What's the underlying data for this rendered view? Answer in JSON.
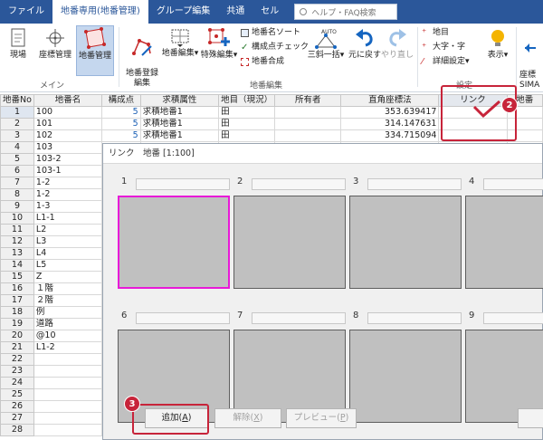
{
  "menubar": {
    "tabs": [
      {
        "label": "ファイル",
        "active": false
      },
      {
        "label": "地番専用(地番管理)",
        "active": true
      },
      {
        "label": "グループ編集",
        "active": false
      },
      {
        "label": "共通",
        "active": false
      },
      {
        "label": "セル",
        "active": false
      }
    ],
    "help_placeholder": "ヘルプ・FAQ検索"
  },
  "ribbon": {
    "main": {
      "items": [
        "現場",
        "座標管理",
        "地番管理"
      ],
      "group": "メイン"
    },
    "chiban": {
      "items": [
        "地番登録\n編集",
        "地番編集",
        "特殊編集"
      ],
      "sort": "地番名ソート",
      "check": "構成点チェック",
      "merge": "地番合成",
      "sankyaku": "三斜一括",
      "undo": "元に戻す",
      "redo": "やり直し",
      "group": "地番編集"
    },
    "settings": {
      "chimoku": "地目",
      "font": "大字・字",
      "detail": "詳細設定",
      "display": "表示",
      "zahyo": "座標\nSIMA",
      "group": "設定"
    }
  },
  "grid": {
    "columns": [
      "地番No",
      "地番名",
      "構成点",
      "求積属性",
      "地目（現況）",
      "所有者",
      "直角座標法",
      "リンク",
      "地番"
    ],
    "rows": [
      {
        "no": "1",
        "name": "100",
        "points": "5",
        "attr": "求積地番1",
        "chimoku": "田",
        "owner": "",
        "area": "353.639417",
        "link": ""
      },
      {
        "no": "2",
        "name": "101",
        "points": "5",
        "attr": "求積地番1",
        "chimoku": "田",
        "owner": "",
        "area": "314.147631",
        "link": ""
      },
      {
        "no": "3",
        "name": "102",
        "points": "5",
        "attr": "求積地番1",
        "chimoku": "田",
        "owner": "",
        "area": "334.715094",
        "link": ""
      },
      {
        "no": "4",
        "name": "103"
      },
      {
        "no": "5",
        "name": "103-2"
      },
      {
        "no": "6",
        "name": "103-1"
      },
      {
        "no": "7",
        "name": "1-2"
      },
      {
        "no": "8",
        "name": "1-2"
      },
      {
        "no": "9",
        "name": "1-3"
      },
      {
        "no": "10",
        "name": "L1-1"
      },
      {
        "no": "11",
        "name": "L2"
      },
      {
        "no": "12",
        "name": "L3"
      },
      {
        "no": "13",
        "name": "L4"
      },
      {
        "no": "14",
        "name": "L5"
      },
      {
        "no": "15",
        "name": "Z"
      },
      {
        "no": "16",
        "name": "１階"
      },
      {
        "no": "17",
        "name": "２階"
      },
      {
        "no": "18",
        "name": "例"
      },
      {
        "no": "19",
        "name": "道路"
      },
      {
        "no": "20",
        "name": "@10"
      },
      {
        "no": "21",
        "name": "L1-2"
      },
      {
        "no": "22",
        "name": ""
      },
      {
        "no": "23",
        "name": ""
      },
      {
        "no": "24",
        "name": ""
      },
      {
        "no": "25",
        "name": ""
      },
      {
        "no": "26",
        "name": ""
      },
      {
        "no": "27",
        "name": ""
      },
      {
        "no": "28",
        "name": ""
      }
    ]
  },
  "dialog": {
    "title": "リンク　地番 [1:100]",
    "cells": [
      "1",
      "2",
      "3",
      "4",
      "6",
      "7",
      "8",
      "9"
    ],
    "buttons": {
      "add": "追加",
      "add_key": "A",
      "remove": "解除",
      "remove_key": "X",
      "preview": "プレビュー",
      "preview_key": "P"
    }
  },
  "callouts": {
    "step2": "2",
    "step3": "3",
    "accent": "#c7243a",
    "select": "#e81ad8"
  }
}
